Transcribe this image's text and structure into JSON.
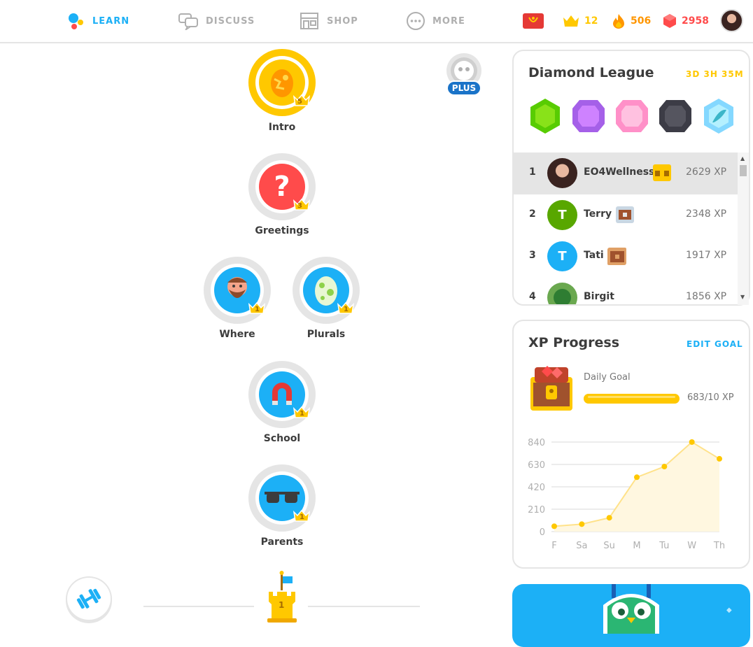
{
  "nav": {
    "learn": "LEARN",
    "discuss": "DISCUSS",
    "shop": "SHOP",
    "more": "MORE"
  },
  "stats": {
    "crowns": "12",
    "streak": "506",
    "gems": "2958"
  },
  "plus_badge": "PLUS",
  "skills": {
    "intro": {
      "label": "Intro",
      "level": "5"
    },
    "greetings": {
      "label": "Greetings",
      "level": "3"
    },
    "where": {
      "label": "Where",
      "level": "1"
    },
    "plurals": {
      "label": "Plurals",
      "level": "1"
    },
    "school": {
      "label": "School",
      "level": "1"
    },
    "parents": {
      "label": "Parents",
      "level": "1"
    },
    "checkpoint": {
      "level": "1"
    }
  },
  "league": {
    "title": "Diamond League",
    "timer": "3D 3H 35M",
    "rows": [
      {
        "rank": "1",
        "name": "EO4Wellness",
        "xp": "2629 XP",
        "initial": ""
      },
      {
        "rank": "2",
        "name": "Terry",
        "xp": "2348 XP",
        "initial": "T"
      },
      {
        "rank": "3",
        "name": "Tati",
        "xp": "1917 XP",
        "initial": "T"
      },
      {
        "rank": "4",
        "name": "Birgit",
        "xp": "1856 XP",
        "initial": ""
      }
    ]
  },
  "xp_progress": {
    "title": "XP Progress",
    "edit_label": "EDIT GOAL",
    "goal_label": "Daily Goal",
    "goal_value": "683/10 XP",
    "goal_fraction": 1.0
  },
  "chart_data": {
    "type": "area",
    "categories": [
      "F",
      "Sa",
      "Su",
      "M",
      "Tu",
      "W",
      "Th"
    ],
    "values": [
      50,
      70,
      130,
      510,
      610,
      840,
      683
    ],
    "yticks": [
      "0",
      "210",
      "420",
      "630",
      "840"
    ],
    "ylim": [
      0,
      840
    ],
    "grid": true,
    "color": "#ffc800",
    "fill": "#fff7e0"
  },
  "colors": {
    "blue": "#1cb0f6",
    "gold": "#ffc800",
    "orange": "#ff9600",
    "red": "#ff4b4b"
  }
}
